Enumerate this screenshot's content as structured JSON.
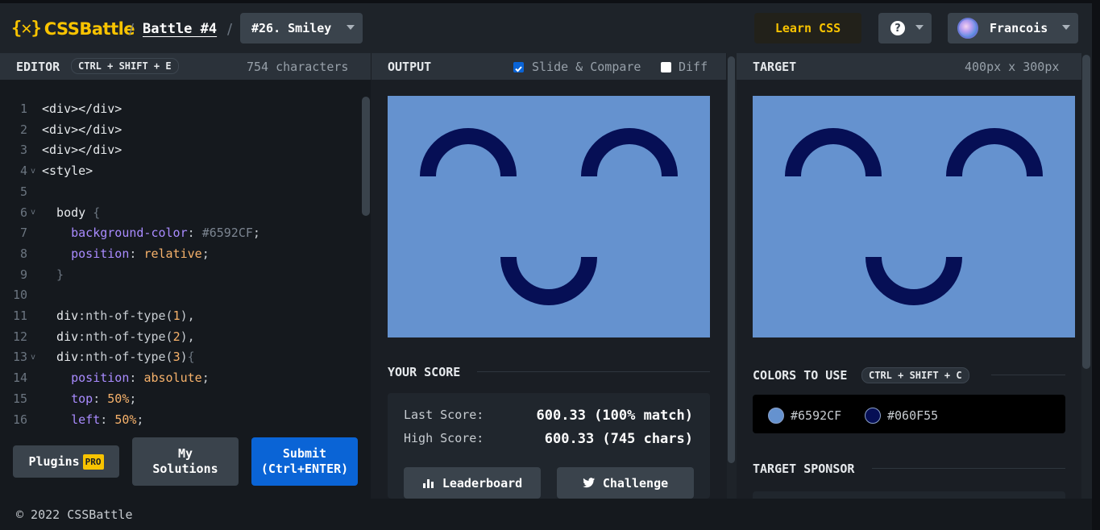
{
  "header": {
    "logo_mark": "{✕}",
    "logo_text": "CSSBattle",
    "sep1": "/",
    "sep2": "/",
    "battle": "Battle #4",
    "target_select": "#26. Smiley",
    "learn": "Learn CSS",
    "help": "?",
    "user": "Francois"
  },
  "editor": {
    "title": "EDITOR",
    "shortcut": "CTRL + SHIFT + E",
    "chars": "754 characters",
    "lines": [
      {
        "n": "1",
        "fold": "",
        "parts": [
          [
            "c-tag",
            "<div></div>"
          ]
        ]
      },
      {
        "n": "2",
        "fold": "",
        "parts": [
          [
            "c-tag",
            "<div></div>"
          ]
        ]
      },
      {
        "n": "3",
        "fold": "",
        "parts": [
          [
            "c-tag",
            "<div></div>"
          ]
        ]
      },
      {
        "n": "4",
        "fold": "v",
        "parts": [
          [
            "c-tag",
            "<style>"
          ]
        ]
      },
      {
        "n": "5",
        "fold": "",
        "parts": []
      },
      {
        "n": "6",
        "fold": "v",
        "parts": [
          [
            "c-tag",
            "  body "
          ],
          [
            "c-brace",
            "{"
          ]
        ]
      },
      {
        "n": "7",
        "fold": "",
        "parts": [
          [
            "c-prop",
            "    background-color"
          ],
          [
            "c-col",
            ": "
          ],
          [
            "c-hex",
            "#6592CF"
          ],
          [
            "c-col",
            ";"
          ]
        ]
      },
      {
        "n": "8",
        "fold": "",
        "parts": [
          [
            "c-prop",
            "    position"
          ],
          [
            "c-col",
            ": "
          ],
          [
            "c-val",
            "relative"
          ],
          [
            "c-col",
            ";"
          ]
        ]
      },
      {
        "n": "9",
        "fold": "",
        "parts": [
          [
            "c-brace",
            "  }"
          ]
        ]
      },
      {
        "n": "10",
        "fold": "",
        "parts": []
      },
      {
        "n": "11",
        "fold": "",
        "parts": [
          [
            "c-tag",
            "  div"
          ],
          [
            "c-col",
            ":nth-of-type("
          ],
          [
            "c-num",
            "1"
          ],
          [
            "c-col",
            "),"
          ]
        ]
      },
      {
        "n": "12",
        "fold": "",
        "parts": [
          [
            "c-tag",
            "  div"
          ],
          [
            "c-col",
            ":nth-of-type("
          ],
          [
            "c-num",
            "2"
          ],
          [
            "c-col",
            "),"
          ]
        ]
      },
      {
        "n": "13",
        "fold": "v",
        "parts": [
          [
            "c-tag",
            "  div"
          ],
          [
            "c-col",
            ":nth-of-type("
          ],
          [
            "c-num",
            "3"
          ],
          [
            "c-col",
            ")"
          ],
          [
            "c-brace",
            "{"
          ]
        ]
      },
      {
        "n": "14",
        "fold": "",
        "parts": [
          [
            "c-prop",
            "    position"
          ],
          [
            "c-col",
            ": "
          ],
          [
            "c-val",
            "absolute"
          ],
          [
            "c-col",
            ";"
          ]
        ]
      },
      {
        "n": "15",
        "fold": "",
        "parts": [
          [
            "c-prop",
            "    top"
          ],
          [
            "c-col",
            ": "
          ],
          [
            "c-num",
            "50%"
          ],
          [
            "c-col",
            ";"
          ]
        ]
      },
      {
        "n": "16",
        "fold": "",
        "parts": [
          [
            "c-prop",
            "    left"
          ],
          [
            "c-col",
            ": "
          ],
          [
            "c-num",
            "50%"
          ],
          [
            "c-col",
            ";"
          ]
        ]
      }
    ],
    "plugins": "Plugins",
    "pro": "PRO",
    "my_solutions_1": "My",
    "my_solutions_2": "Solutions",
    "submit_1": "Submit",
    "submit_2": "(Ctrl+ENTER)"
  },
  "output": {
    "title": "OUTPUT",
    "slide_compare": "Slide & Compare",
    "diff": "Diff",
    "score_title": "YOUR SCORE",
    "last_score_label": "Last Score:",
    "last_score_value": "600.33 (100% match)",
    "high_score_label": "High Score:",
    "high_score_value": "600.33 (745 chars)",
    "leaderboard": "Leaderboard",
    "challenge": "Challenge"
  },
  "target": {
    "title": "TARGET",
    "size": "400px x 300px",
    "colors_title": "COLORS TO USE",
    "colors_shortcut": "CTRL + SHIFT + C",
    "colors": [
      {
        "hex": "#6592CF"
      },
      {
        "hex": "#060F55"
      }
    ],
    "sponsor_title": "TARGET SPONSOR"
  },
  "footer": {
    "copyright": "© 2022 CSSBattle"
  },
  "theme": {
    "accent_yellow": "#f8c300",
    "submit_blue": "#0a64d6",
    "canvas_bg": "#6592cf",
    "shape_color": "#060f55"
  }
}
